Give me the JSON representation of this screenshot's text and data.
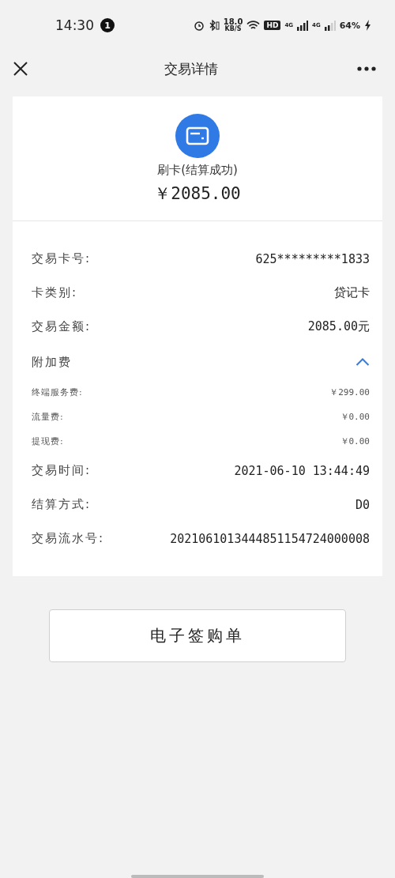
{
  "status_bar": {
    "time": "14:30",
    "notification_count": "1",
    "speed": "18.0",
    "speed_unit": "KB/S",
    "hd": "HD",
    "network_1": "4G",
    "network_2": "4G",
    "battery": "64%"
  },
  "nav": {
    "title": "交易详情"
  },
  "summary": {
    "type": "刷卡(结算成功)",
    "amount": "￥2085.00"
  },
  "rows_top": [
    {
      "label": "交易卡号:",
      "value": "625*********1833"
    },
    {
      "label": "卡类别:",
      "value": "贷记卡"
    },
    {
      "label": "交易金额:",
      "value": "2085.00元"
    }
  ],
  "fees": {
    "label": "附加费",
    "expanded": true,
    "items": [
      {
        "label": "终端服务费:",
        "value": "￥299.00"
      },
      {
        "label": "流量费:",
        "value": "￥0.00"
      },
      {
        "label": "提现费:",
        "value": "￥0.00"
      }
    ]
  },
  "rows_bottom": [
    {
      "label": "交易时间:",
      "value": "2021-06-10 13:44:49"
    },
    {
      "label": "结算方式:",
      "value": "D0"
    },
    {
      "label": "交易流水号:",
      "value": "2021061013444851154724000008"
    }
  ],
  "button": "电子签购单"
}
